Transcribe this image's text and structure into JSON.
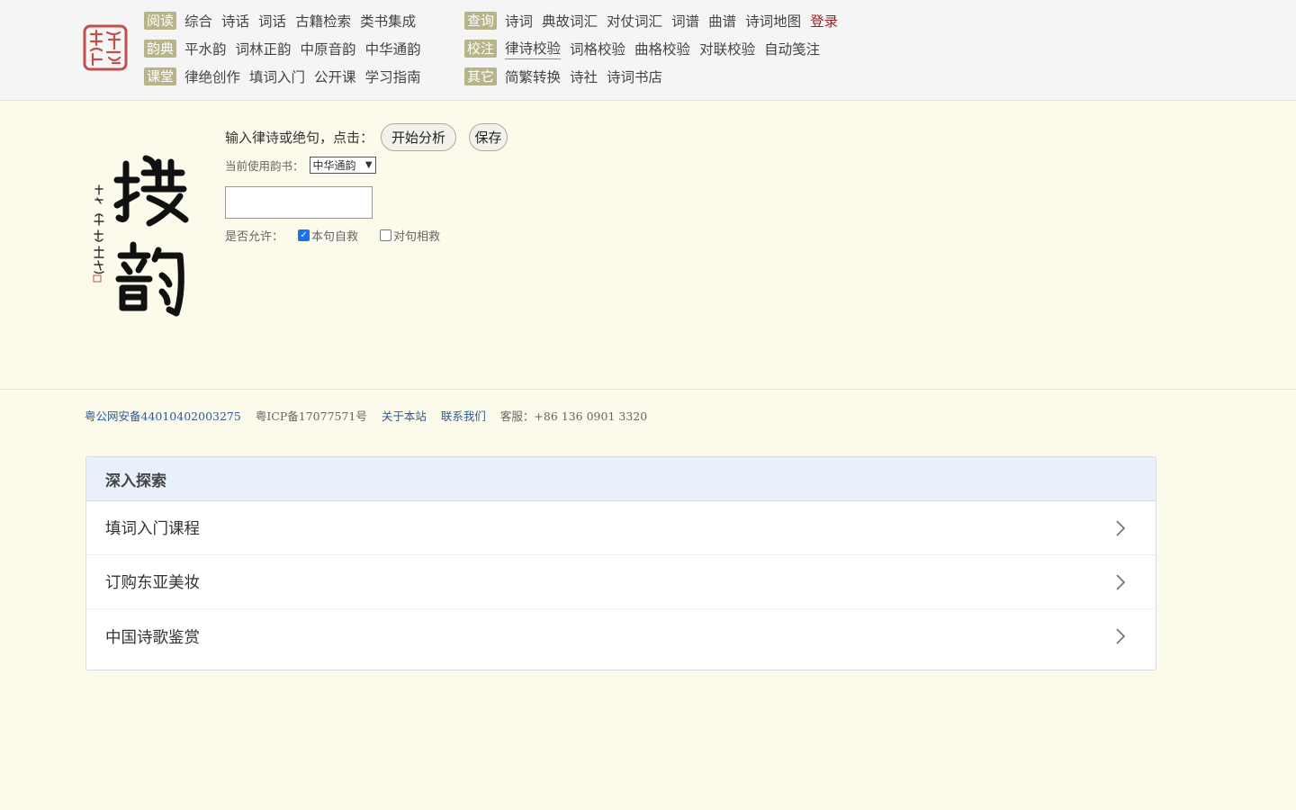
{
  "header": {
    "logo": {
      "icon": "seal-logo-icon",
      "color": "#c0504d"
    },
    "nav_groups": [
      {
        "tag": "阅读",
        "links": [
          "综合",
          "诗话",
          "词话",
          "古籍检索",
          "类书集成"
        ]
      },
      {
        "tag": "查询",
        "links": [
          "诗词",
          "典故词汇",
          "对仗词汇",
          "词谱",
          "曲谱",
          "诗词地图"
        ],
        "login": "登录"
      },
      {
        "tag": "韵典",
        "links": [
          "平水韵",
          "词林正韵",
          "中原音韵",
          "中华通韵"
        ]
      },
      {
        "tag": "校注",
        "links": [
          "律诗校验",
          "词格校验",
          "曲格校验",
          "对联校验",
          "自动笺注"
        ],
        "active": "律诗校验"
      },
      {
        "tag": "课堂",
        "links": [
          "律绝创作",
          "填词入门",
          "公开课",
          "学习指南"
        ]
      },
      {
        "tag": "其它",
        "links": [
          "简繁转换",
          "诗社",
          "诗词书店"
        ]
      }
    ]
  },
  "tool": {
    "prompt": "输入律诗或绝句，点击：",
    "analyze_button": "开始分析",
    "save_button": "保存",
    "rhyme_label": "当前使用韵书：",
    "rhyme_selected": "中华通韵",
    "poem_value": "",
    "allow_label": "是否允许：",
    "options": [
      {
        "label": "本句自救",
        "checked": true
      },
      {
        "label": "对句相救",
        "checked": false
      }
    ],
    "calligraphy": {
      "chars": [
        "搜",
        "韵"
      ],
      "image": "calligraphy-title"
    }
  },
  "footer": {
    "police_record": "粤公网安备44010402003275",
    "icp": "粤ICP备17077571号",
    "about": "关于本站",
    "contact": "联系我们",
    "service": "客服：+86 136 0901 3320"
  },
  "explore": {
    "title": "深入探索",
    "items": [
      "填词入门课程",
      "订购东亚美妆",
      "中国诗歌鉴赏"
    ]
  },
  "colors": {
    "background": "#fbfaeb",
    "tag": "#b8b48a",
    "link": "#2d5b9a",
    "login": "#9b1c1c",
    "card_head": "#e8f0fc"
  }
}
